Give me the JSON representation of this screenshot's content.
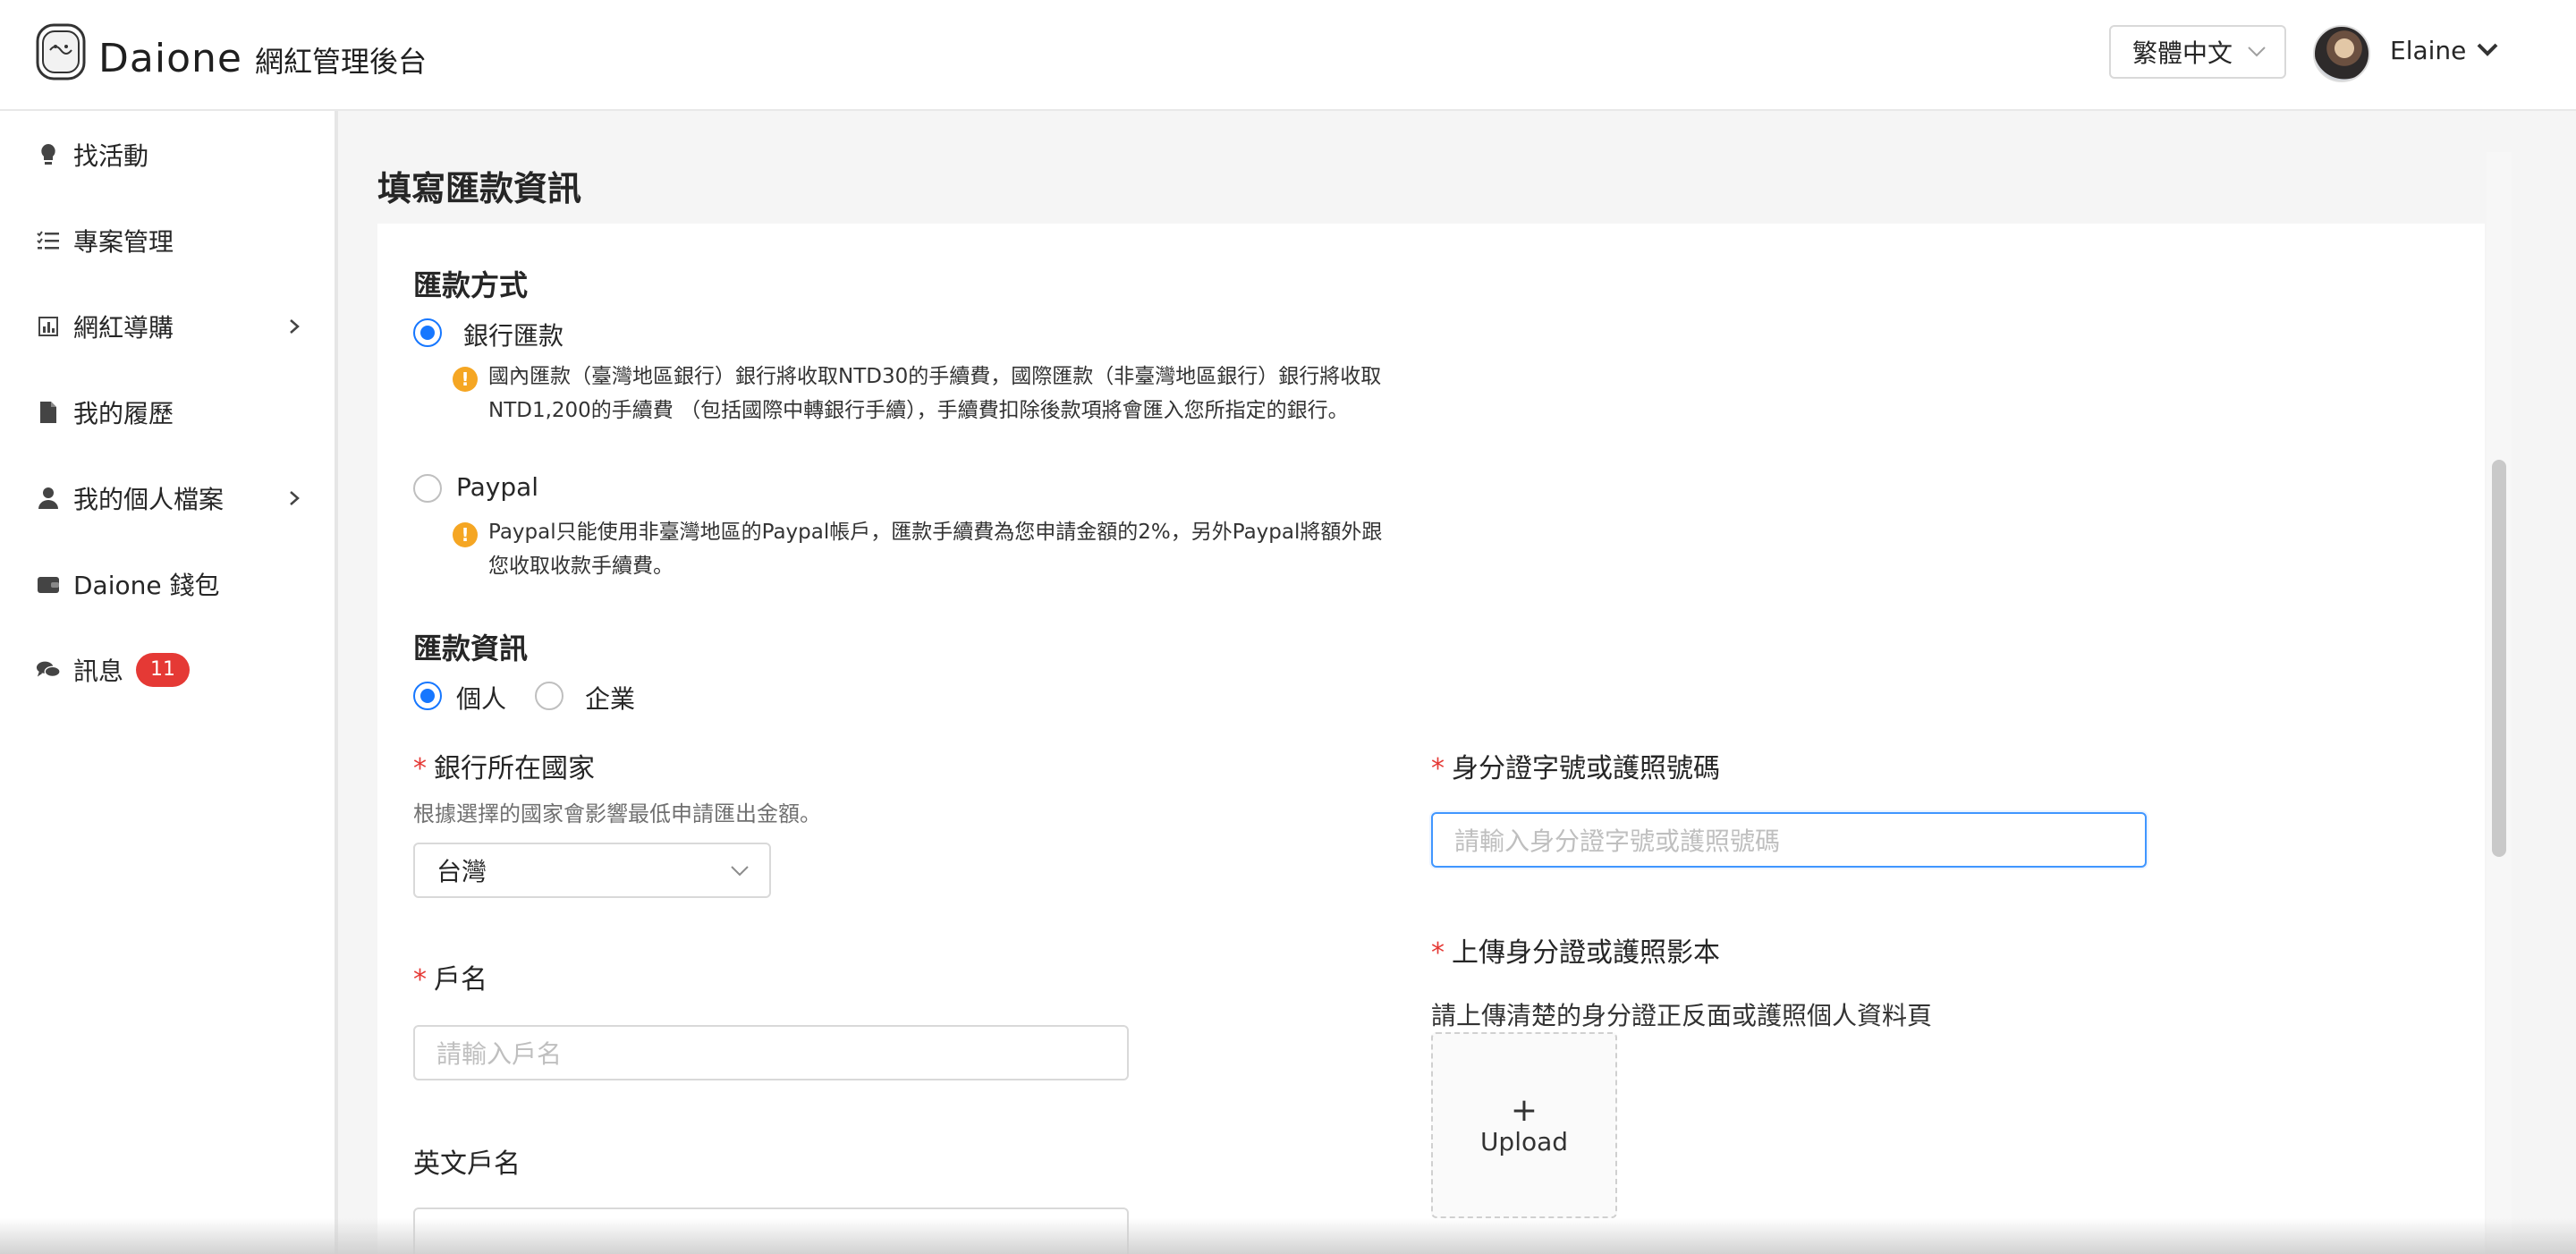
{
  "header": {
    "brand_name": "Daione",
    "brand_sub": "網紅管理後台",
    "language": "繁體中文",
    "user_name": "Elaine"
  },
  "sidebar": {
    "items": [
      {
        "label": "找活動",
        "icon": "lightbulb-icon",
        "has_arrow": false
      },
      {
        "label": "專案管理",
        "icon": "list-check-icon",
        "has_arrow": false
      },
      {
        "label": "網紅導購",
        "icon": "chart-icon",
        "has_arrow": true
      },
      {
        "label": "我的履歷",
        "icon": "document-icon",
        "has_arrow": false
      },
      {
        "label": "我的個人檔案",
        "icon": "user-icon",
        "has_arrow": true
      },
      {
        "label": "Daione 錢包",
        "icon": "wallet-icon",
        "has_arrow": false
      },
      {
        "label": "訊息",
        "icon": "chat-icon",
        "has_arrow": false,
        "badge": "11"
      }
    ]
  },
  "page": {
    "title": "填寫匯款資訊",
    "remittance_method": {
      "title": "匯款方式",
      "options": [
        {
          "label": "銀行匯款",
          "checked": true,
          "notice": "國內匯款（臺灣地區銀行）銀行將收取NTD30的手續費，國際匯款（非臺灣地區銀行）銀行將收取NTD1,200的手續費 （包括國際中轉銀行手續），手續費扣除後款項將會匯入您所指定的銀行。"
        },
        {
          "label": "Paypal",
          "checked": false,
          "notice": "Paypal只能使用非臺灣地區的Paypal帳戶，匯款手續費為您申請金額的2%，另外Paypal將額外跟您收取收款手續費。"
        }
      ]
    },
    "remittance_info": {
      "title": "匯款資訊",
      "type_options": [
        {
          "label": "個人",
          "checked": true
        },
        {
          "label": "企業",
          "checked": false
        }
      ]
    },
    "fields": {
      "bank_country": {
        "label": "銀行所在國家",
        "required": "*",
        "help": "根據選擇的國家會影響最低申請匯出金額。",
        "value": "台灣"
      },
      "account_name": {
        "label": "戶名",
        "required": "*",
        "placeholder": "請輸入戶名"
      },
      "english_name": {
        "label": "英文戶名"
      },
      "id_number": {
        "label": "身分證字號或護照號碼",
        "required": "*",
        "placeholder": "請輸入身分證字號或護照號碼"
      },
      "id_upload": {
        "label": "上傳身分證或護照影本",
        "required": "*",
        "help": "請上傳清楚的身分證正反面或護照個人資料頁",
        "button": "Upload",
        "plus": "+"
      }
    }
  }
}
